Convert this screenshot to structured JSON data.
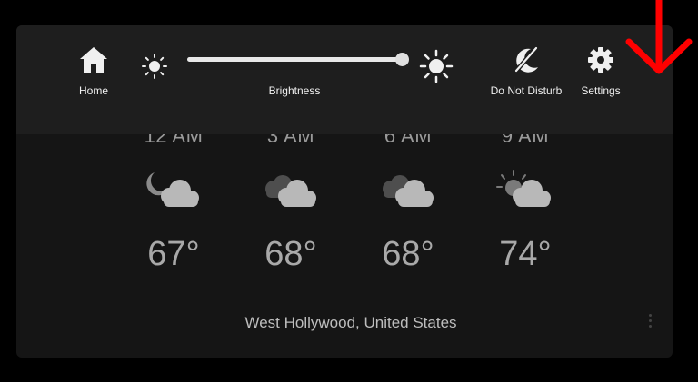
{
  "quick_settings": {
    "home_label": "Home",
    "brightness_label": "Brightness",
    "brightness_level": 0.99,
    "dnd_label": "Do Not Disturb",
    "settings_label": "Settings"
  },
  "forecast": [
    {
      "time": "12 AM",
      "icon": "night-cloudy-icon",
      "temp": "67°"
    },
    {
      "time": "3 AM",
      "icon": "cloudy-icon",
      "temp": "68°"
    },
    {
      "time": "6 AM",
      "icon": "cloudy-icon",
      "temp": "68°"
    },
    {
      "time": "9 AM",
      "icon": "partly-sunny-icon",
      "temp": "74°"
    }
  ],
  "location": "West Hollywood, United States",
  "colors": {
    "panel_bg": "#1e1e1e",
    "screen_bg": "#151515",
    "annotation_arrow": "#ff0000"
  }
}
